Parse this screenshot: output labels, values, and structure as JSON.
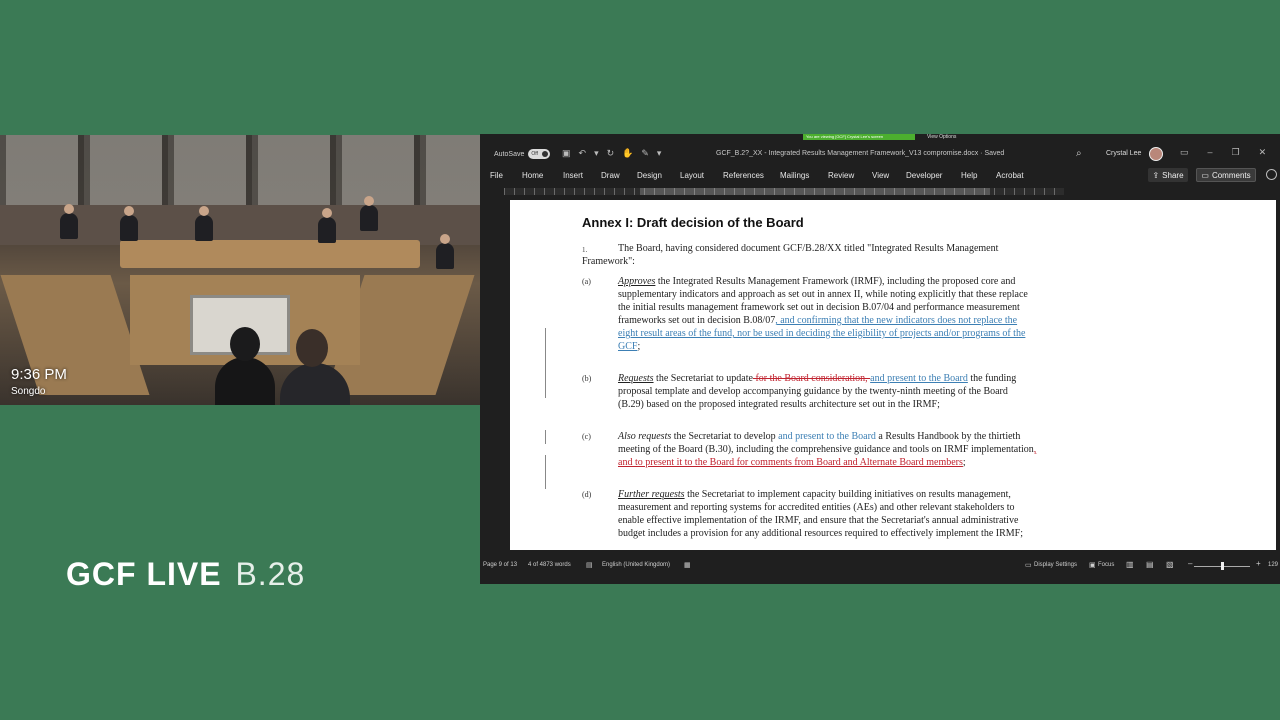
{
  "camera": {
    "time": "9:36 PM",
    "location": "Songdo"
  },
  "brand": {
    "name": "GCF LIVE",
    "session": "B.28"
  },
  "word": {
    "share_banner": "You are viewing [GCF] Crystal Lee's screen",
    "view_options": "View Options",
    "autosave_label": "AutoSave",
    "autosave_state": "Off",
    "document_title": "GCF_B.2?_XX - Integrated Results Management Framework_V13 compromise.docx · Saved",
    "user_name": "Crystal Lee",
    "menu": [
      "File",
      "Home",
      "Insert",
      "Draw",
      "Design",
      "Layout",
      "References",
      "Mailings",
      "Review",
      "View",
      "Developer",
      "Help",
      "Acrobat"
    ],
    "share_label": "Share",
    "comments_label": "Comments",
    "status": {
      "page": "Page 9 of 13",
      "words": "4 of 4873 words",
      "language": "English (United Kingdom)",
      "display_settings": "Display Settings",
      "focus": "Focus",
      "zoom": "129"
    }
  },
  "doc": {
    "heading": "Annex I: Draft decision of the Board",
    "p1_num": "1.",
    "p1_text": "The Board, having considered document GCF/B.28/XX titled \"Integrated Results Management Framework\":",
    "a_label": "(a)",
    "a_em": "Approves",
    "a_text": " the Integrated Results Management Framework (IRMF), including the proposed core and supplementary indicators and approach as set out in annex II, while noting explicitly that these replace the initial results management framework set out in decision B.07/04 and performance measurement frameworks set out in decision B.08/07",
    "a_ins": ", and confirming that the new indicators does not replace the eight result areas of the fund, nor be used in deciding the eligibility of projects and/or programs of the GCF",
    "a_end": ";",
    "b_label": "(b)",
    "b_em": "Requests",
    "b_text1": " the Secretariat to update",
    "b_del": " for the Board consideration, ",
    "b_ins": " and present to the Board",
    "b_text2": " the funding proposal template and develop accompanying guidance by the twenty-ninth meeting of the Board (B.29) based on the proposed integrated results architecture set out in the IRMF;",
    "c_label": "(c)",
    "c_em": "Also requests",
    "c_text1": " the Secretariat to develop ",
    "c_ins": "and present to the Board",
    "c_text2": " a Results Handbook by the thirtieth meeting of the Board (B.30), including the comprehensive guidance and tools on IRMF implementation",
    "c_red": ", and to present it to the Board for comments from Board and Alternate Board members",
    "c_end": ";",
    "d_label": "(d)",
    "d_em": "Further requests",
    "d_text": " the Secretariat to implement capacity building initiatives on results management, measurement and reporting systems for accredited entities (AEs) and other relevant stakeholders to enable effective implementation of the IRMF, and ensure that the Secretariat's annual administrative budget includes a provision for any additional resources required to effectively implement the IRMF;"
  }
}
